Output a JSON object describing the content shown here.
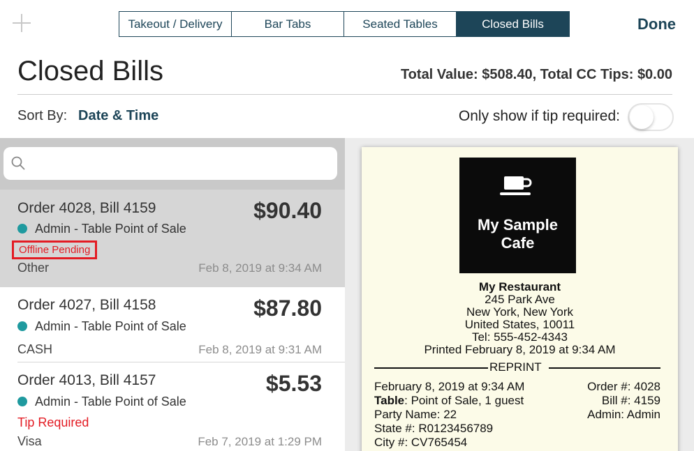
{
  "toolbar": {
    "tabs": [
      {
        "label": "Takeout / Delivery"
      },
      {
        "label": "Bar Tabs"
      },
      {
        "label": "Seated Tables"
      },
      {
        "label": "Closed Bills"
      }
    ],
    "done_label": "Done"
  },
  "header": {
    "title": "Closed Bills",
    "totals": "Total Value: $508.40, Total CC Tips: $0.00"
  },
  "controls": {
    "sort_label": "Sort By:",
    "sort_value": "Date & Time",
    "tip_filter_label": "Only show if tip required:",
    "tip_filter_on": false
  },
  "search": {
    "placeholder": ""
  },
  "bills": [
    {
      "title": "Order 4028, Bill 4159",
      "amount": "$90.40",
      "user": "Admin - Table Point of Sale",
      "status": "Offline Pending",
      "method": "Other",
      "date": "Feb 8, 2019 at 9:34 AM"
    },
    {
      "title": "Order 4027, Bill 4158",
      "amount": "$87.80",
      "user": "Admin - Table Point of Sale",
      "status": "",
      "method": "CASH",
      "date": "Feb 8, 2019 at 9:31 AM"
    },
    {
      "title": "Order 4013, Bill 4157",
      "amount": "$5.53",
      "user": "Admin - Table Point of Sale",
      "status": "Tip Required",
      "method": "Visa",
      "date": "Feb 7, 2019 at 1:29 PM"
    }
  ],
  "receipt": {
    "logo_text": "My Sample Cafe",
    "restaurant": "My Restaurant",
    "address1": "245 Park Ave",
    "address2": "New York, New York",
    "address3": "United States, 10011",
    "phone": "Tel: 555-452-4343",
    "printed": "Printed February 8, 2019 at 9:34 AM",
    "reprint": "REPRINT",
    "date": "February 8, 2019 at 9:34 AM",
    "table_label": "Table",
    "table_value": ": Point of Sale, 1 guest",
    "party": "Party Name: 22",
    "state": "State #: R0123456789",
    "city": "City #: CV765454",
    "order_no": "Order #: 4028",
    "bill_no": "Bill #: 4159",
    "admin": "Admin: Admin"
  },
  "colors": {
    "accent": "#1d4558",
    "status_dot": "#1f9a9f",
    "alert": "#e31b23"
  }
}
